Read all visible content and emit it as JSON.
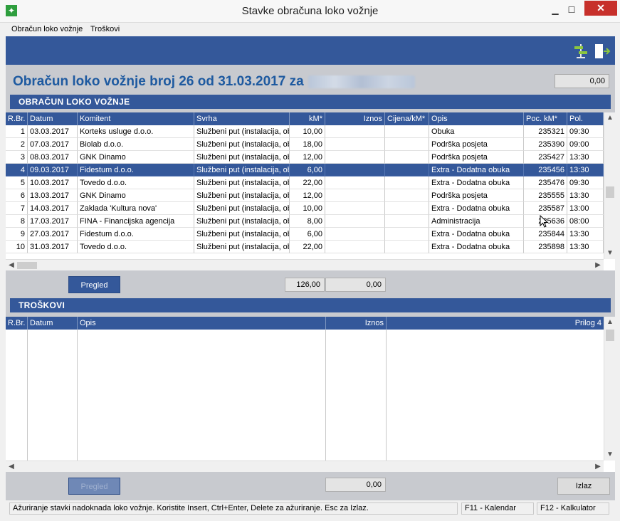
{
  "window": {
    "title": "Stavke obračuna loko vožnje"
  },
  "menu": [
    "Obračun loko vožnje",
    "Troškovi"
  ],
  "header": {
    "title_prefix": "Obračun loko vožnje broj 26 od 31.03.2017 za",
    "total": "0,00"
  },
  "section1": {
    "title": "OBRAČUN LOKO VOŽNJE"
  },
  "grid1": {
    "columns": [
      "R.Br.",
      "Datum",
      "Komitent",
      "Svrha",
      "kM*",
      "Iznos",
      "Cijena/kM*",
      "Opis",
      "Poc. kM*",
      "Pol."
    ],
    "rows": [
      [
        "1",
        "03.03.2017",
        "Korteks usluge d.o.o.",
        "Službeni put (instalacija, obu",
        "10,00",
        "",
        "",
        "Obuka",
        "235321",
        "09:30"
      ],
      [
        "2",
        "07.03.2017",
        "Biolab d.o.o.",
        "Službeni put (instalacija, obu",
        "18,00",
        "",
        "",
        "Podrška posjeta",
        "235390",
        "09:00"
      ],
      [
        "3",
        "08.03.2017",
        "GNK Dinamo",
        "Službeni put (instalacija, obu",
        "12,00",
        "",
        "",
        "Podrška posjeta",
        "235427",
        "13:30"
      ],
      [
        "4",
        "09.03.2017",
        "Fidestum d.o.o.",
        "Službeni put (instalacija, obu",
        "6,00",
        "",
        "",
        "Extra - Dodatna obuka",
        "235456",
        "13:30"
      ],
      [
        "5",
        "10.03.2017",
        "Tovedo d.o.o.",
        "Službeni put (instalacija, obu",
        "22,00",
        "",
        "",
        "Extra - Dodatna obuka",
        "235476",
        "09:30"
      ],
      [
        "6",
        "13.03.2017",
        "GNK Dinamo",
        "Službeni put (instalacija, obu",
        "12,00",
        "",
        "",
        "Podrška posjeta",
        "235555",
        "13:30"
      ],
      [
        "7",
        "14.03.2017",
        "Zaklada 'Kultura nova'",
        "Službeni put (instalacija, obu",
        "10,00",
        "",
        "",
        "Extra - Dodatna obuka",
        "235587",
        "13:00"
      ],
      [
        "8",
        "17.03.2017",
        "FINA - Financijska agencija",
        "Službeni put (instalacija, obu",
        "8,00",
        "",
        "",
        "Administracija",
        "235636",
        "08:00"
      ],
      [
        "9",
        "27.03.2017",
        "Fidestum d.o.o.",
        "Službeni put (instalacija, obu",
        "6,00",
        "",
        "",
        "Extra - Dodatna obuka",
        "235844",
        "13:30"
      ],
      [
        "10",
        "31.03.2017",
        "Tovedo d.o.o.",
        "Službeni put (instalacija, obu",
        "22,00",
        "",
        "",
        "Extra - Dodatna obuka",
        "235898",
        "13:30"
      ]
    ],
    "selected_row": 3
  },
  "summary1": {
    "button": "Pregled",
    "km_total": "126,00",
    "iznos_total": "0,00"
  },
  "section2": {
    "title": "TROŠKOVI"
  },
  "grid2": {
    "columns": [
      "R.Br.",
      "Datum",
      "Opis",
      "Iznos",
      "Prilog 4"
    ]
  },
  "summary2": {
    "button": "Pregled",
    "iznos_total": "0,00",
    "exit": "Izlaz"
  },
  "status": {
    "message": "Ažuriranje stavki nadoknada loko vožnje. Koristite Insert, Ctrl+Enter, Delete za ažuriranje. Esc za Izlaz.",
    "f11": "F11 - Kalendar",
    "f12": "F12 - Kalkulator"
  },
  "colors": {
    "accent": "#34589a",
    "title_text": "#1e5aa0",
    "close_button": "#c7302b"
  },
  "icons": [
    "app-icon",
    "minimize-icon",
    "maximize-icon",
    "close-icon",
    "signpost-icon",
    "exit-door-icon",
    "scroll-up-icon",
    "scroll-down-icon",
    "scroll-left-icon",
    "scroll-right-icon",
    "mouse-cursor-icon"
  ]
}
